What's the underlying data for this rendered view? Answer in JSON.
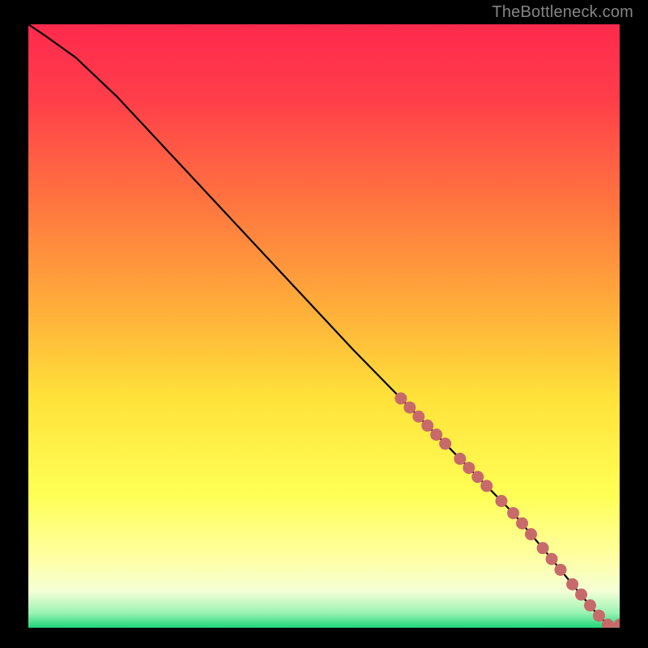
{
  "attribution": "TheBottleneck.com",
  "colors": {
    "background": "#000000",
    "gradient_top": "#ff2a4d",
    "gradient_upper_mid": "#ff8d3e",
    "gradient_mid": "#ffe23a",
    "gradient_lower_mid": "#ffff8a",
    "gradient_pale": "#f7ffd8",
    "gradient_bottom": "#1dd67a",
    "curve_stroke": "#000000",
    "marker_fill": "#c86a6a"
  },
  "chart_data": {
    "type": "line",
    "title": "",
    "xlabel": "",
    "ylabel": "",
    "xlim": [
      0,
      100
    ],
    "ylim": [
      0,
      100
    ],
    "series": [
      {
        "name": "bottleneck-curve",
        "x": [
          0,
          3,
          8,
          15,
          25,
          35,
          45,
          55,
          63,
          70,
          76,
          82,
          88,
          93,
          96,
          98,
          100
        ],
        "y": [
          100,
          98,
          94.5,
          88,
          77.5,
          67,
          56.5,
          46,
          38,
          31,
          25,
          19,
          12,
          6,
          2.5,
          0.5,
          0.5
        ]
      }
    ],
    "markers": [
      {
        "x": 63.0,
        "y": 38.0
      },
      {
        "x": 64.5,
        "y": 36.5
      },
      {
        "x": 66.0,
        "y": 35.0
      },
      {
        "x": 67.5,
        "y": 33.5
      },
      {
        "x": 69.0,
        "y": 32.0
      },
      {
        "x": 70.5,
        "y": 30.5
      },
      {
        "x": 73.0,
        "y": 28.0
      },
      {
        "x": 74.5,
        "y": 26.5
      },
      {
        "x": 76.0,
        "y": 25.0
      },
      {
        "x": 77.5,
        "y": 23.5
      },
      {
        "x": 80.0,
        "y": 21.0
      },
      {
        "x": 82.0,
        "y": 19.0
      },
      {
        "x": 83.5,
        "y": 17.3
      },
      {
        "x": 85.0,
        "y": 15.5
      },
      {
        "x": 87.0,
        "y": 13.2
      },
      {
        "x": 88.5,
        "y": 11.4
      },
      {
        "x": 90.0,
        "y": 9.6
      },
      {
        "x": 92.0,
        "y": 7.2
      },
      {
        "x": 93.5,
        "y": 5.5
      },
      {
        "x": 95.0,
        "y": 3.7
      },
      {
        "x": 96.5,
        "y": 2.0
      },
      {
        "x": 98.0,
        "y": 0.5
      },
      {
        "x": 100.0,
        "y": 0.5
      }
    ],
    "gradient_stops": [
      {
        "offset": 0.0,
        "color": "#ff2a4d"
      },
      {
        "offset": 0.12,
        "color": "#ff3d4a"
      },
      {
        "offset": 0.3,
        "color": "#ff763f"
      },
      {
        "offset": 0.48,
        "color": "#ffb13a"
      },
      {
        "offset": 0.62,
        "color": "#ffe23a"
      },
      {
        "offset": 0.78,
        "color": "#ffff55"
      },
      {
        "offset": 0.88,
        "color": "#ffffa0"
      },
      {
        "offset": 0.94,
        "color": "#f4ffd6"
      },
      {
        "offset": 0.975,
        "color": "#9cf3b4"
      },
      {
        "offset": 1.0,
        "color": "#1dd67a"
      }
    ]
  }
}
